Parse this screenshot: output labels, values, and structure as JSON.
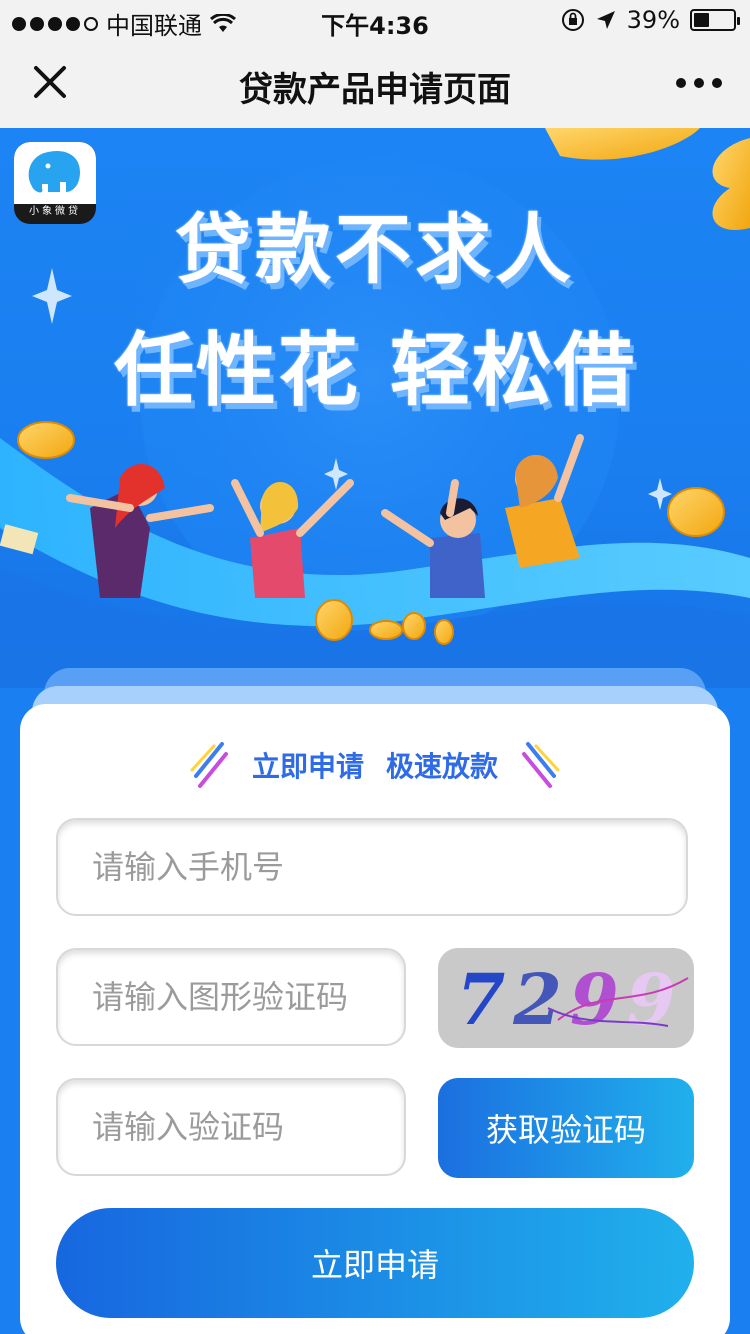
{
  "status_bar": {
    "carrier": "中国联通",
    "time": "下午4:36",
    "battery": "39%",
    "battery_level": 0.39
  },
  "nav": {
    "title": "贷款产品申请页面"
  },
  "banner": {
    "logo_text": "小象微贷",
    "headline_line1": "贷款不求人",
    "headline_line2": "任性花 轻松借"
  },
  "form": {
    "slogan_left": "立即申请",
    "slogan_right": "极速放款",
    "phone_placeholder": "请输入手机号",
    "captcha_placeholder": "请输入图形验证码",
    "captcha_digits": [
      "7",
      "2",
      "9",
      "9"
    ],
    "sms_placeholder": "请输入验证码",
    "get_code_label": "获取验证码",
    "submit_label": "立即申请"
  },
  "colors": {
    "primary_blue": "#1a7ff0",
    "button_gradient_start": "#1767df",
    "button_gradient_end": "#20b0ec",
    "slogan_blue": "#2f6be6"
  }
}
